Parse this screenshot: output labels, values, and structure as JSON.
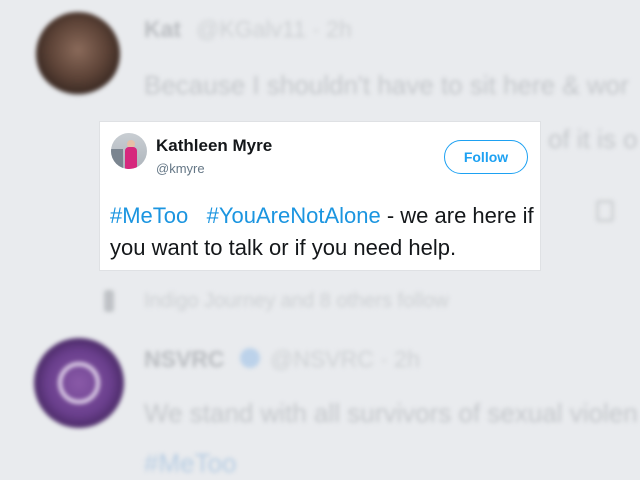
{
  "background_feed": {
    "tweet_1": {
      "name": "Kat",
      "handle_time": "@KGalv11 · 2h",
      "text_line_1": "Because I shouldn't have to sit here & wor",
      "text_line_2_end": "of it is o"
    },
    "follow_line": "Indigo Journey and 8 others follow",
    "tweet_2": {
      "name": "NSVRC",
      "handle_time": "@NSVRC · 2h",
      "text_line_1": "We stand with all survivors of sexual violen",
      "hashtag": "#MeToo"
    }
  },
  "tweet": {
    "display_name": "Kathleen Myre",
    "handle": "@kmyre",
    "follow_label": "Follow",
    "hashtag_1": "#MeToo",
    "hashtag_2": "#YouAreNotAlone",
    "text_rest": " - we are here if you want to talk or if you need help."
  },
  "colors": {
    "twitter_blue": "#1da1f2",
    "hashtag_blue": "#1b95e0",
    "text_dark": "#14171a",
    "text_gray": "#657786",
    "background": "#e9ebee"
  },
  "icons": {
    "follow_context": "person-icon",
    "verified": "verified-badge-icon",
    "direct_message": "message-icon"
  }
}
